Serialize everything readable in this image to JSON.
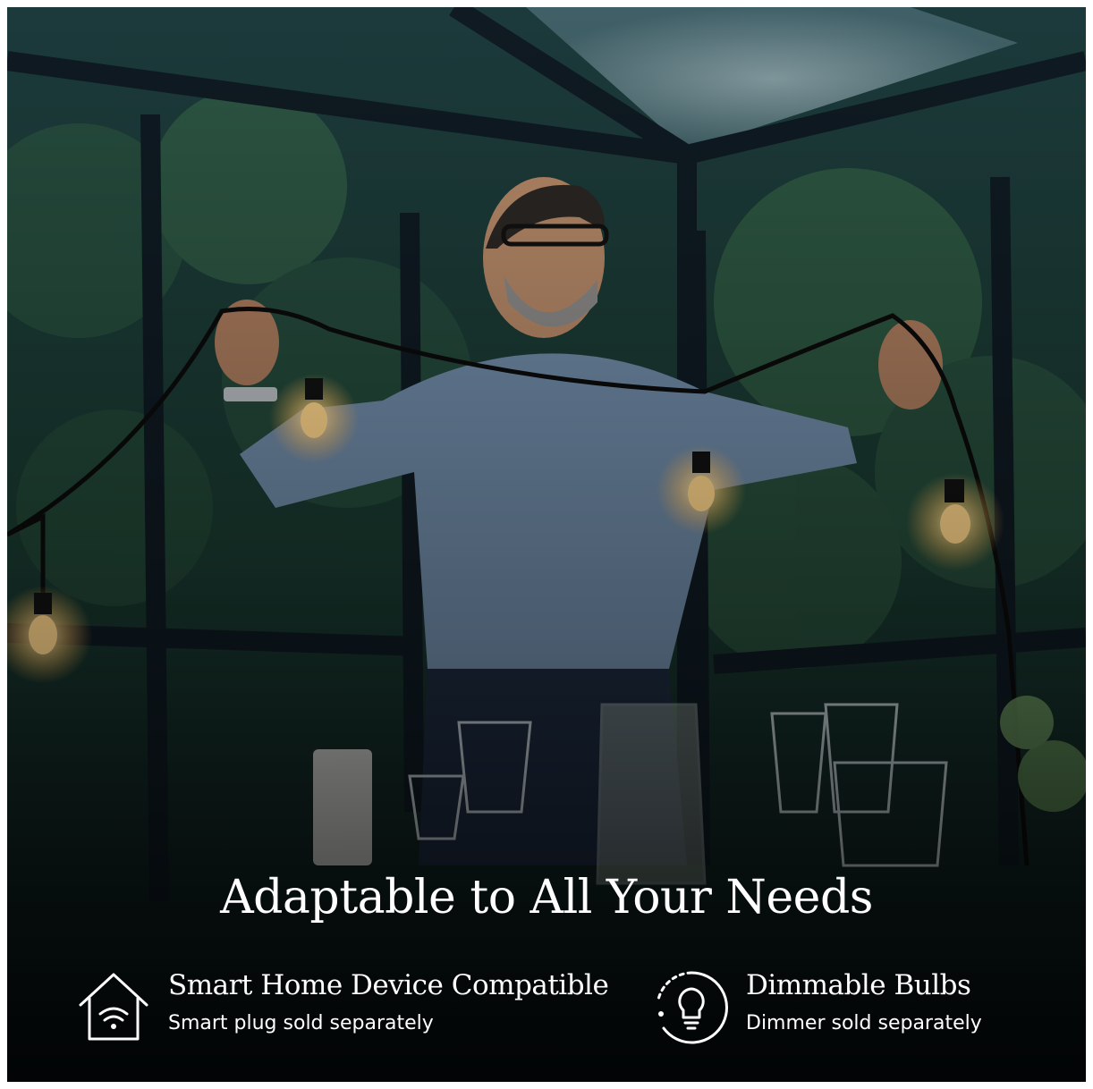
{
  "headline": "Adaptable to All Your Needs",
  "features": [
    {
      "icon": "smart-home-wifi-icon",
      "title": "Smart Home Device Compatible",
      "subtitle": "Smart plug sold separately"
    },
    {
      "icon": "dimmable-bulb-icon",
      "title": "Dimmable Bulbs",
      "subtitle": "Dimmer sold separately"
    }
  ],
  "colors": {
    "text": "#ffffff",
    "background": "#0d1a1f",
    "bulb_glow": "#ffd58a"
  }
}
